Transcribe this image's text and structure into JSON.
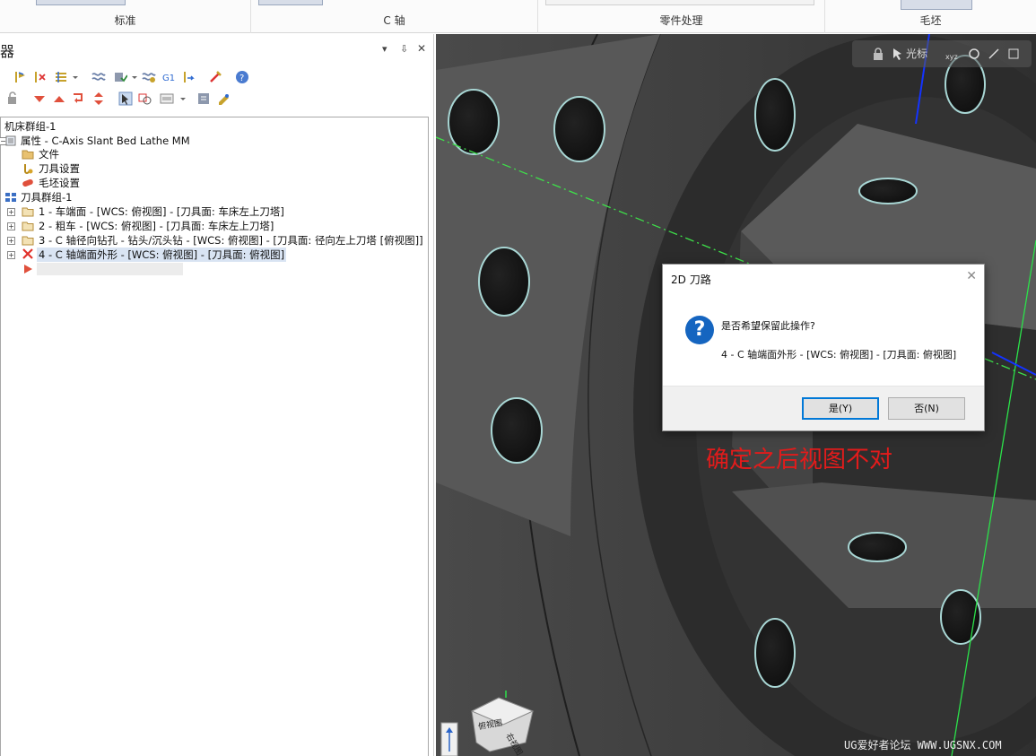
{
  "ribbon": {
    "groups": [
      "标准",
      "C 轴",
      "零件处理",
      "毛坯"
    ]
  },
  "panel": {
    "title": "器",
    "controls": [
      "▾",
      "⇩",
      "✕"
    ]
  },
  "tree": {
    "machine_group": "机床群组-1",
    "properties": "属性 - C-Axis Slant Bed Lathe MM",
    "files": "文件",
    "tool_settings": "刀具设置",
    "stock_settings": "毛坯设置",
    "toolpath_group": "刀具群组-1",
    "operations": [
      "1 - 车端面 - [WCS: 俯视图] - [刀具面: 车床左上刀塔]",
      "2 - 粗车 - [WCS: 俯视图] - [刀具面: 车床左上刀塔]",
      "3 - C 轴径向钻孔 - 钻头/沉头钻 - [WCS: 俯视图] - [刀具面: 径向左上刀塔 [俯视图]]",
      "4 - C 轴端面外形 - [WCS: 俯视图] - [刀具面: 俯视图]"
    ]
  },
  "viewport_toolbar": {
    "cursor_label": "光标"
  },
  "dialog": {
    "title": "2D 刀路",
    "question": "是否希望保留此操作?",
    "detail": "4 - C 轴端面外形 - [WCS: 俯视图] - [刀具面: 俯视图]",
    "yes_label": "是(Y)",
    "no_label": "否(N)"
  },
  "view_cube": {
    "face_top": "俯视图",
    "face_right": "右视图"
  },
  "annotation": "确定之后视图不对",
  "watermark": "UG爱好者论坛 WWW.UGSNX.COM",
  "colors": {
    "accent": "#0078d7",
    "annotation": "#e21b1b",
    "question_icon": "#1565c0",
    "selection": "#d9e4f3"
  }
}
